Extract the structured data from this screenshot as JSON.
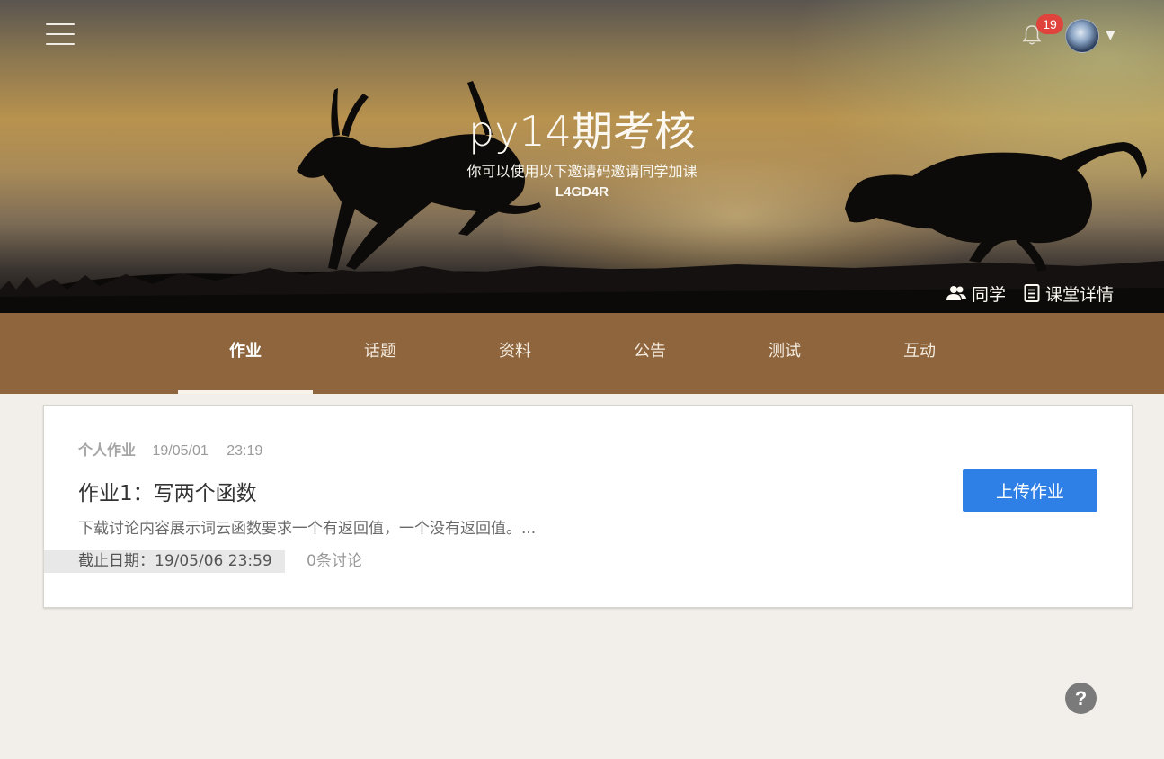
{
  "header": {
    "notification_count": "19",
    "course_title": "py14期考核",
    "invite_text": "你可以使用以下邀请码邀请同学加课",
    "invite_code": "L4GD4R",
    "links": {
      "classmates": "同学",
      "course_details": "课堂详情"
    }
  },
  "tabs": [
    {
      "label": "作业",
      "active": true
    },
    {
      "label": "话题",
      "active": false
    },
    {
      "label": "资料",
      "active": false
    },
    {
      "label": "公告",
      "active": false
    },
    {
      "label": "测试",
      "active": false
    },
    {
      "label": "互动",
      "active": false
    }
  ],
  "assignment": {
    "type": "个人作业",
    "date": "19/05/01",
    "time": "23:19",
    "title": "作业1：写两个函数",
    "description": "下载讨论内容展示词云函数要求一个有返回值，一个没有返回值。...",
    "deadline": "截止日期：19/05/06   23:59",
    "discussion": "0条讨论",
    "upload_label": "上传作业"
  },
  "help": {
    "label": "?"
  },
  "colors": {
    "tab_bar": "#8e653c",
    "upload_button": "#2f80e6",
    "badge": "#e0433b",
    "page_background": "#f2efea"
  }
}
